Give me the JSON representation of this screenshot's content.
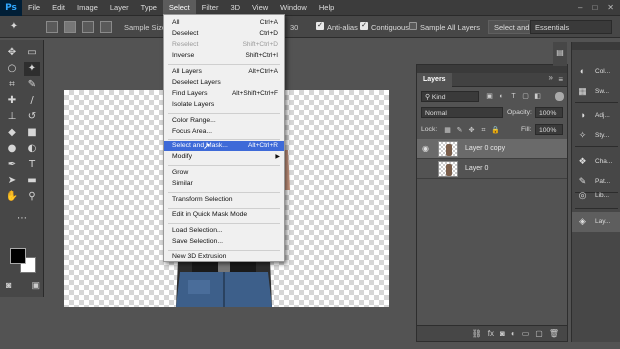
{
  "app": {
    "logo": "Ps"
  },
  "menubar": {
    "items": [
      "File",
      "Edit",
      "Image",
      "Layer",
      "Type",
      "Select",
      "Filter",
      "3D",
      "View",
      "Window",
      "Help"
    ],
    "active": "Select",
    "window_controls": [
      "–",
      "□",
      "✕"
    ]
  },
  "options": {
    "sample_size_label": "Sample Size",
    "tolerance_value": "30",
    "anti_alias": {
      "label": "Anti-alias",
      "checked": true
    },
    "contiguous": {
      "label": "Contiguous",
      "checked": true
    },
    "sample_all_layers": {
      "label": "Sample All Layers",
      "checked": false
    },
    "select_and_btn": "Select and",
    "workspace": "Essentials"
  },
  "select_menu": {
    "items": [
      {
        "label": "All",
        "shortcut": "Ctrl+A"
      },
      {
        "label": "Deselect",
        "shortcut": "Ctrl+D"
      },
      {
        "label": "Reselect",
        "shortcut": "Shift+Ctrl+D",
        "disabled": true
      },
      {
        "label": "Inverse",
        "shortcut": "Shift+Ctrl+I"
      },
      {
        "label": "All Layers",
        "shortcut": "Alt+Ctrl+A"
      },
      {
        "label": "Deselect Layers",
        "shortcut": ""
      },
      {
        "label": "Find Layers",
        "shortcut": "Alt+Shift+Ctrl+F"
      },
      {
        "label": "Isolate Layers",
        "shortcut": ""
      },
      {
        "label": "Color Range...",
        "shortcut": ""
      },
      {
        "label": "Focus Area...",
        "shortcut": ""
      },
      {
        "label": "Select and Mask...",
        "shortcut": "Alt+Ctrl+R",
        "highlighted": true
      },
      {
        "label": "Modify",
        "shortcut": "",
        "submenu": true
      },
      {
        "label": "Grow",
        "shortcut": ""
      },
      {
        "label": "Similar",
        "shortcut": ""
      },
      {
        "label": "Transform Selection",
        "shortcut": ""
      },
      {
        "label": "Edit in Quick Mask Mode",
        "shortcut": ""
      },
      {
        "label": "Load Selection...",
        "shortcut": ""
      },
      {
        "label": "Save Selection...",
        "shortcut": ""
      },
      {
        "label": "New 3D Extrusion",
        "shortcut": ""
      }
    ]
  },
  "layers_panel": {
    "tab": "Layers",
    "kind_filter": "Kind",
    "blend_mode": "Normal",
    "opacity_label": "Opacity:",
    "opacity_value": "100%",
    "lock_label": "Lock:",
    "fill_label": "Fill:",
    "fill_value": "100%",
    "layers": [
      {
        "name": "Layer 0 copy",
        "visible": true,
        "selected": true
      },
      {
        "name": "Layer 0",
        "visible": false,
        "selected": false
      }
    ]
  },
  "dock": {
    "items": [
      {
        "label": "Col...",
        "icon": "color-icon"
      },
      {
        "label": "Sw...",
        "icon": "swatches-icon"
      },
      {
        "label": "Adj...",
        "icon": "adjustments-icon"
      },
      {
        "label": "Sty...",
        "icon": "styles-icon"
      },
      {
        "label": "Cha...",
        "icon": "channels-icon"
      },
      {
        "label": "Pat...",
        "icon": "paths-icon"
      },
      {
        "label": "Lib...",
        "icon": "libraries-icon"
      },
      {
        "label": "Lay...",
        "icon": "layers-icon"
      }
    ]
  },
  "colors": {
    "foreground": "#000000",
    "background": "#ffffff",
    "menu_highlight": "#3e6ad8",
    "ps_brand": "#31a8ff"
  }
}
